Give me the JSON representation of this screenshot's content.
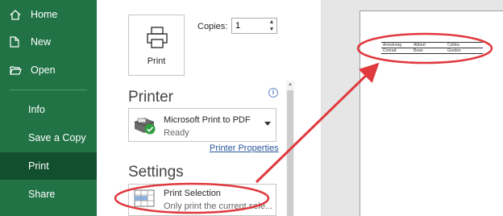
{
  "nav": {
    "home": "Home",
    "new": "New",
    "open": "Open",
    "info": "Info",
    "save_copy": "Save a Copy",
    "print": "Print",
    "share": "Share"
  },
  "print": {
    "button_label": "Print",
    "copies_label": "Copies:",
    "copies_value": "1"
  },
  "printer": {
    "section_title": "Printer",
    "name": "Microsoft Print to PDF",
    "status": "Ready",
    "properties_link": "Printer Properties"
  },
  "settings": {
    "section_title": "Settings",
    "print_what": "Print Selection",
    "print_what_desc": "Only print the current sele..."
  },
  "preview": {
    "rows": [
      [
        "Armstrong",
        "Abbert",
        "Collins"
      ],
      [
        "Conrad",
        "Bean",
        "Gordon"
      ]
    ]
  },
  "colors": {
    "nav_bg": "#217346",
    "nav_selected": "#124f2f",
    "annotation": "#e0393e",
    "link": "#2b579a"
  }
}
